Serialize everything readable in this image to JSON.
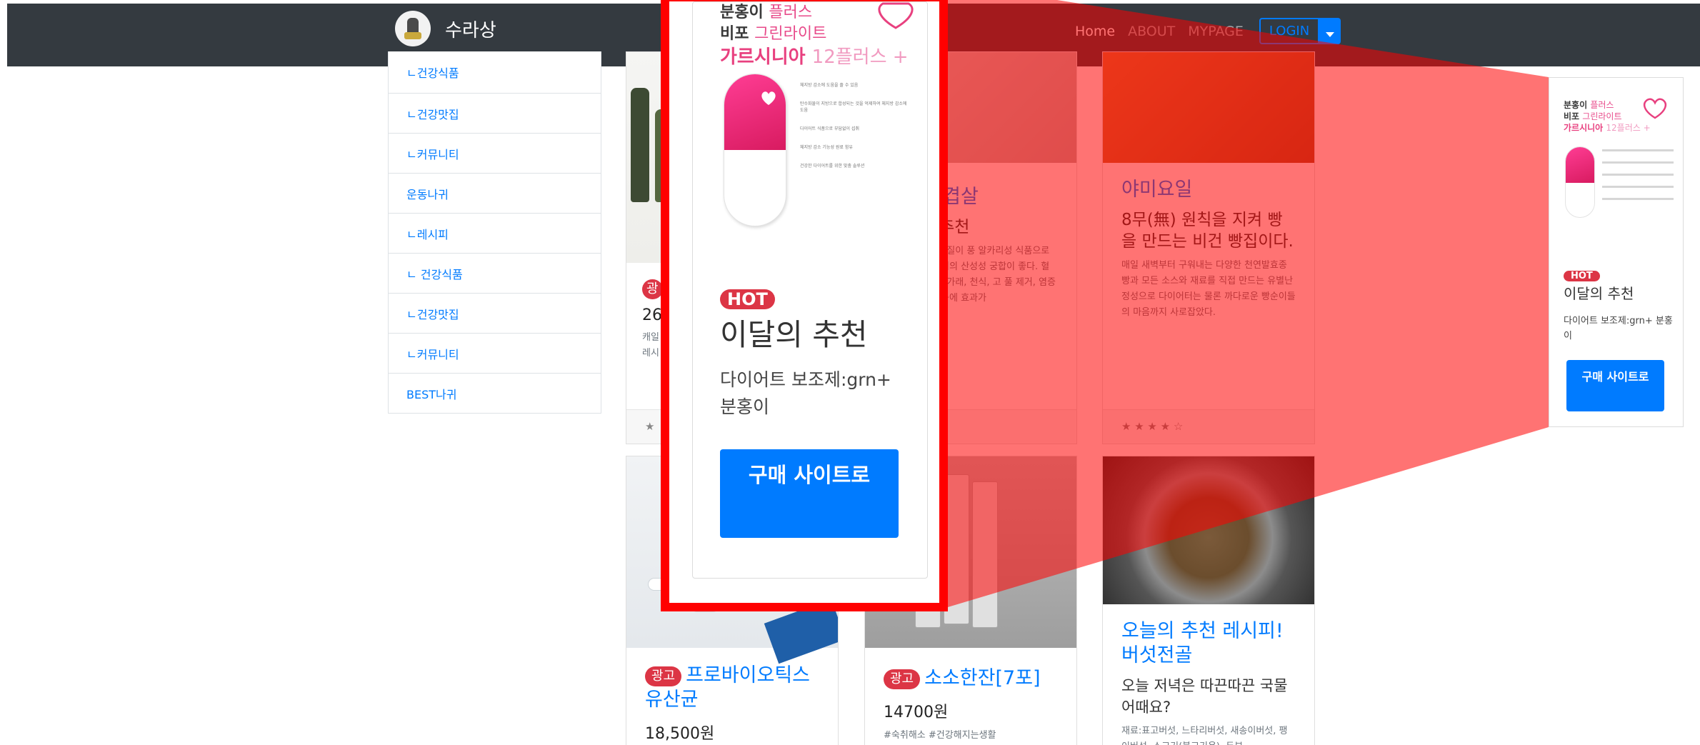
{
  "navbar": {
    "brand": "수라상",
    "links": [
      "Home",
      "ABOUT",
      "MYPAGE"
    ],
    "login_label": "LOGIN"
  },
  "sidebar": {
    "items": [
      "ㄴ건강식품",
      "ㄴ건강맛집",
      "ㄴ커뮤니티",
      "운동나귀",
      "ㄴ레시피",
      "ㄴ 건강식품",
      "ㄴ건강맛집",
      "ㄴ커뮤니티",
      "BEST나귀"
    ]
  },
  "cards": {
    "row1": [
      {
        "title": "",
        "sub": "",
        "text": "",
        "price_partial": "26",
        "text_partial": "캐일 레시",
        "badge_partial": "광",
        "footer": "★"
      },
      {
        "title": "더덕 삼겹살",
        "sub": "삼 맛집 추천",
        "text": "음, 인 등의 무기질이 풍 알카리성 식품으로 고 섭취하면 고기의 산성성 궁합이 좋다. 혈관질환 로 회복, 가래, 천식, 고 풀 제거, 염증치료와 장기능 등에 효과가",
        "footer": ""
      },
      {
        "title": "야미요일",
        "sub": "8무(無) 원칙을 지켜 빵을 만드는 비건 빵집이다.",
        "text": "매일 새벽부터 구워내는 다양한 천연발효종 빵과 모든 소스와 재료를 직접 만드는 유별난 정성으로 다이어터는 물론 까다로운 빵순이들의 마음까지 사로잡았다.",
        "footer": "★ ★ ★ ★ ☆"
      }
    ],
    "row2": [
      {
        "badge": "광고",
        "title": "프로바이오틱스 유산균",
        "price": "18,500원"
      },
      {
        "badge": "광고",
        "title": "소소한잔[7포]",
        "price": "14700원",
        "text": "#숙취해소 #건강해지는생활"
      },
      {
        "title": "오늘의 추천 레시피! 버섯전골",
        "sub": "오늘 저녁은 따끈따끈 국물 어때요?",
        "text": "재료:표고버섯, 느타리버섯, 새송이버섯, 팽이버섯, 소고기(불고기용), 두부"
      }
    ]
  },
  "ad": {
    "line1": "분홍이",
    "line1_soft": "플러스",
    "line2": "비포",
    "line2_soft": "그린라이트",
    "line3": "가르시니아",
    "line3_soft": "12플러스 +",
    "bullets": [
      "체지방 감소에 도움을 줄 수 있음",
      "탄수화물이 지방으로 합성되는 것을 억제하여 체지방 감소에 도움",
      "다이어트 식품으로 부담없이 섭취",
      "체지방 감소 기능성 원료 함유",
      "건강한 다이어트를 위한 맞춤 솔루션"
    ],
    "hot": "HOT",
    "recommend": "이달의 추천",
    "desc": "다이어트 보조제:grn+ 분홍이",
    "buy": "구매 사이트로"
  },
  "colors": {
    "navbar": "#343a40",
    "primary": "#007bff",
    "danger": "#dc3545",
    "highlight": "#ff0000"
  }
}
